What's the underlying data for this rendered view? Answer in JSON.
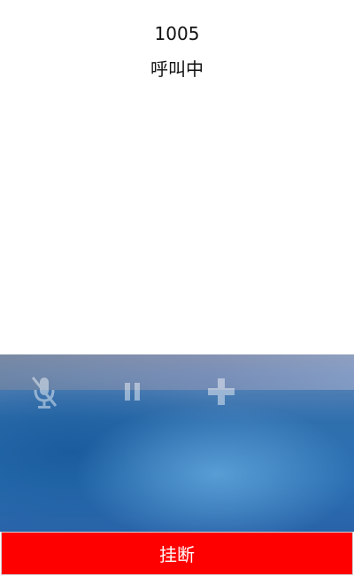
{
  "call": {
    "number": "1005",
    "status": "呼叫中"
  },
  "controls": {
    "mute": {
      "icon": "microphone-muted-icon"
    },
    "hold": {
      "icon": "pause-icon"
    },
    "add": {
      "icon": "plus-icon"
    }
  },
  "hangup": {
    "label": "挂断",
    "color": "#ff0000"
  }
}
